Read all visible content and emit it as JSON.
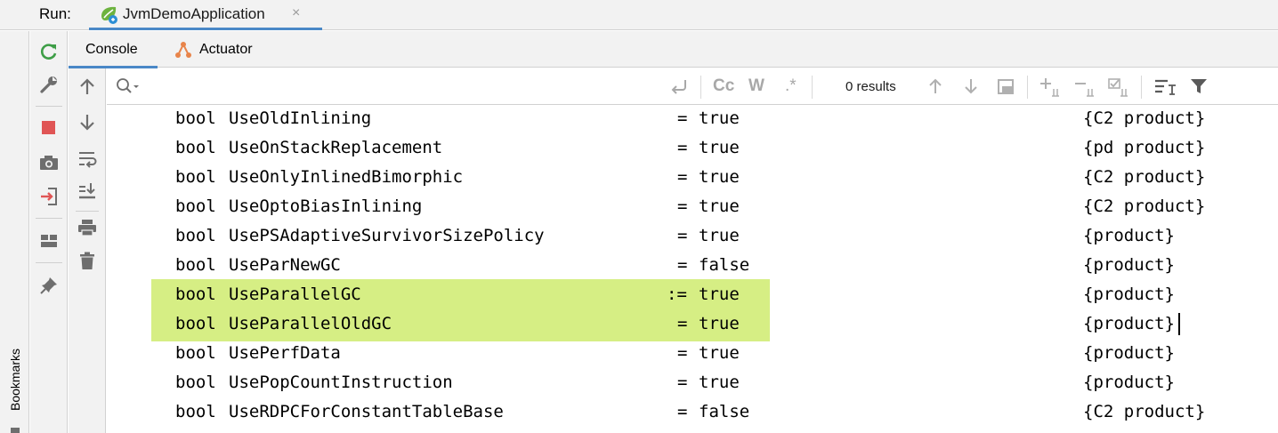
{
  "run_bar": {
    "label": "Run:",
    "tab": {
      "title": "JvmDemoApplication",
      "close_glyph": "×",
      "icon": "spring-boot-icon"
    }
  },
  "bookmarks": {
    "label": "Bookmarks",
    "icon": "bookmark-icon"
  },
  "run_toolbar": {
    "icons": [
      "rerun-icon",
      "wrench-icon",
      "stop-icon",
      "camera-icon",
      "login-icon",
      "layout-icon",
      "pin-icon"
    ],
    "colors": {
      "rerun": "#3e9e47",
      "stop": "#e05555",
      "default": "#6e6e6e"
    }
  },
  "console_tabs": [
    {
      "label": "Console",
      "icon": ""
    },
    {
      "label": "Actuator",
      "icon": "actuator-icon"
    }
  ],
  "console_toolbar": {
    "icons": [
      "up-arrow-icon",
      "down-arrow-icon",
      "soft-wrap-icon",
      "scroll-to-end-icon",
      "print-icon",
      "trash-icon"
    ]
  },
  "search": {
    "placeholder": "",
    "value": "",
    "results_text": "0 results",
    "match_case_label": "Cc",
    "words_label": "W",
    "regex_label": ".*"
  },
  "output": {
    "lines": [
      {
        "type": "bool",
        "name": "UseOldInlining",
        "op": "=",
        "value": "true",
        "kind": "{C2 product}"
      },
      {
        "type": "bool",
        "name": "UseOnStackReplacement",
        "op": "=",
        "value": "true",
        "kind": "{pd product}"
      },
      {
        "type": "bool",
        "name": "UseOnlyInlinedBimorphic",
        "op": "=",
        "value": "true",
        "kind": "{C2 product}"
      },
      {
        "type": "bool",
        "name": "UseOptoBiasInlining",
        "op": "=",
        "value": "true",
        "kind": "{C2 product}"
      },
      {
        "type": "bool",
        "name": "UsePSAdaptiveSurvivorSizePolicy",
        "op": "=",
        "value": "true",
        "kind": "{product}"
      },
      {
        "type": "bool",
        "name": "UseParNewGC",
        "op": "=",
        "value": "false",
        "kind": "{product}"
      },
      {
        "type": "bool",
        "name": "UseParallelGC",
        "op": ":=",
        "value": "true",
        "kind": "{product}"
      },
      {
        "type": "bool",
        "name": "UseParallelOldGC",
        "op": "=",
        "value": "true",
        "kind": "{product}"
      },
      {
        "type": "bool",
        "name": "UsePerfData",
        "op": "=",
        "value": "true",
        "kind": "{product}"
      },
      {
        "type": "bool",
        "name": "UsePopCountInstruction",
        "op": "=",
        "value": "true",
        "kind": "{product}"
      },
      {
        "type": "bool",
        "name": "UseRDPCForConstantTableBase",
        "op": "=",
        "value": "false",
        "kind": "{C2 product}"
      }
    ],
    "highlight_color": "#d6ee84"
  },
  "colors": {
    "accent": "#4a88c7",
    "panel_bg": "#f2f2f2",
    "border": "#d1d1d1"
  }
}
